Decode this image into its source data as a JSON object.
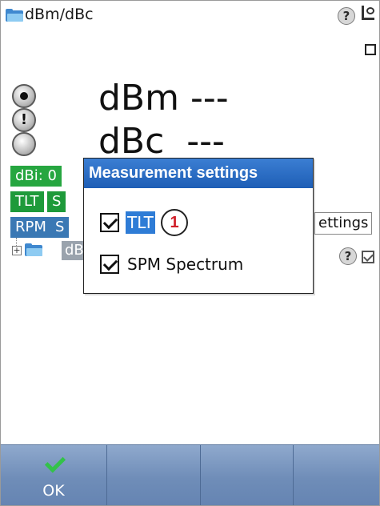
{
  "window": {
    "title": "dBm/dBc",
    "folder_icon": "folder-icon",
    "help_icon": "help-icon",
    "help_glyph": "?",
    "right_icon": "antenna-icon"
  },
  "readings": {
    "dbm_label": "dBm ---",
    "dbc_label": "dBc  ---",
    "led1_icon": "record-led-icon",
    "led2_icon": "warning-led-icon",
    "led2_glyph": "!",
    "led3_icon": "status-led-icon"
  },
  "chips": {
    "dbi": "dBi: 0",
    "tlt": "TLT",
    "s1": "S",
    "rpm": "RPM",
    "s2": "S"
  },
  "tree": {
    "expand_glyph": "+",
    "label": "dB",
    "settings_cut": "ettings"
  },
  "popup": {
    "title": "Measurement settings",
    "options": [
      {
        "label": "TLT",
        "checked": true,
        "selected": true
      },
      {
        "label": "SPM Spectrum",
        "checked": true,
        "selected": false
      }
    ],
    "annotation": "1"
  },
  "bottombar": {
    "ok_label": "OK",
    "ok_icon": "check-icon"
  },
  "colors": {
    "accent_blue": "#1f5fb6",
    "chip_green": "#26a640",
    "chip_blue": "#3a78b4",
    "bottom_bar": "#6f8db8",
    "annotation_red": "#d0202a"
  }
}
